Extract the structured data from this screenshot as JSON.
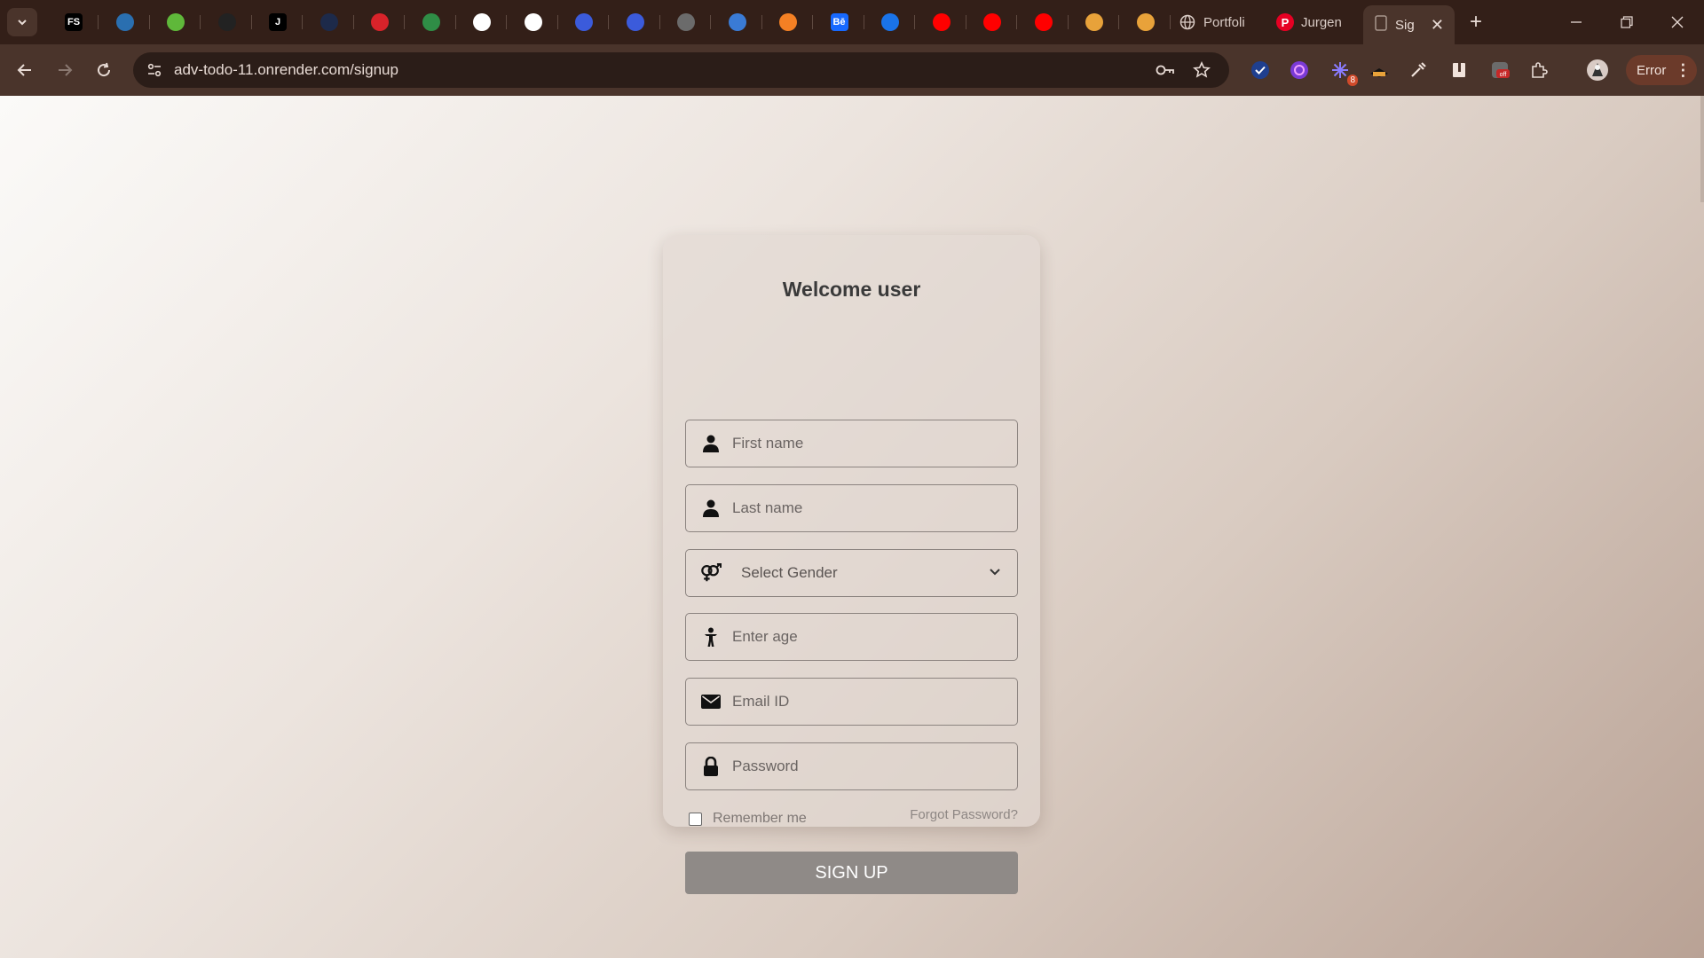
{
  "browser": {
    "pinned_tabs": [
      {
        "icon": "fs-icon",
        "text": "FS",
        "color": "#000000"
      },
      {
        "icon": "wave-icon",
        "text": "",
        "color": "#2a6fb0"
      },
      {
        "icon": "leaf-icon",
        "text": "",
        "color": "#5fb83a"
      },
      {
        "icon": "timer-icon",
        "text": "",
        "color": "#222222"
      },
      {
        "icon": "j-icon",
        "text": "J",
        "color": "#000000"
      },
      {
        "icon": "si-icon",
        "text": "",
        "color": "#1d2a4a"
      },
      {
        "icon": "opera-icon",
        "text": "",
        "color": "#d8232a"
      },
      {
        "icon": "gfg-icon",
        "text": "",
        "color": "#2f8d46"
      },
      {
        "icon": "w3-icon",
        "text": "",
        "color": "#ffffff"
      },
      {
        "icon": "w3-icon",
        "text": "",
        "color": "#ffffff"
      },
      {
        "icon": "compass-icon",
        "text": "",
        "color": "#3b5bdb"
      },
      {
        "icon": "compass-icon",
        "text": "",
        "color": "#3b5bdb"
      },
      {
        "icon": "network-icon",
        "text": "",
        "color": "#6b6b6b"
      },
      {
        "icon": "globe-stripe-icon",
        "text": "",
        "color": "#3a7bd5"
      },
      {
        "icon": "stack-icon",
        "text": "",
        "color": "#f48024"
      },
      {
        "icon": "behance-icon",
        "text": "Bē",
        "color": "#1769ff"
      },
      {
        "icon": "play-circle-icon",
        "text": "",
        "color": "#1a73e8"
      },
      {
        "icon": "youtube-icon",
        "text": "",
        "color": "#ff0000"
      },
      {
        "icon": "youtube-icon",
        "text": "",
        "color": "#ff0000"
      },
      {
        "icon": "youtube-icon",
        "text": "",
        "color": "#ff0000"
      },
      {
        "icon": "mountain-icon",
        "text": "",
        "color": "#e8a23a"
      },
      {
        "icon": "mountain-icon",
        "text": "",
        "color": "#e8a23a"
      }
    ],
    "tabs": [
      {
        "label": "Portfoli",
        "icon": "globe-icon"
      },
      {
        "label": "Jurgen",
        "icon": "pinterest-icon"
      }
    ],
    "active_tab": {
      "label": "Sig"
    },
    "url": "adv-todo-11.onrender.com/signup",
    "error_label": "Error"
  },
  "form": {
    "title": "Welcome user",
    "first_name_placeholder": "First name",
    "last_name_placeholder": "Last name",
    "gender_label": "Select Gender",
    "age_placeholder": "Enter age",
    "email_placeholder": "Email ID",
    "password_placeholder": "Password",
    "remember_label": "Remember me",
    "remember_checked": false,
    "forgot_label": "Forgot Password?",
    "submit_label": "SIGN UP"
  }
}
